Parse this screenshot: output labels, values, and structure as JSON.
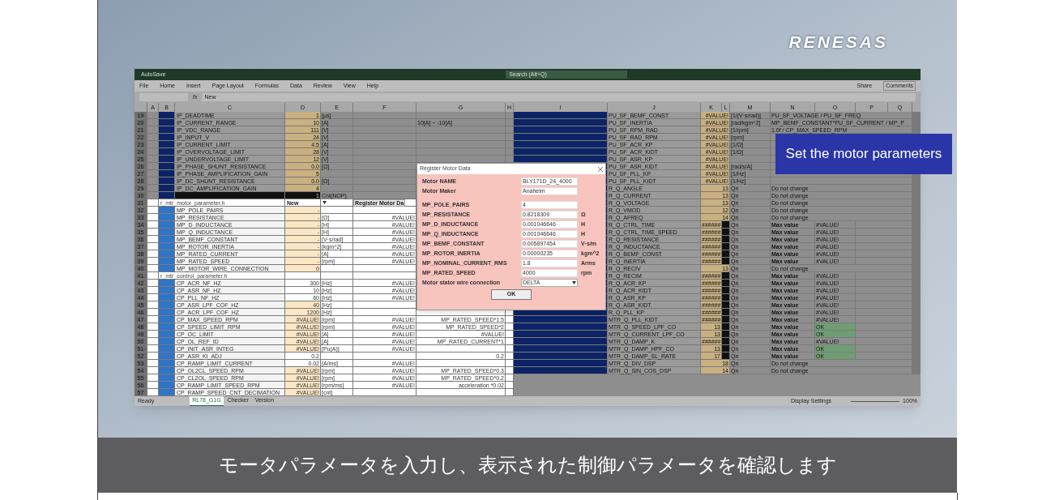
{
  "logo": "RENESAS",
  "excel": {
    "autosave": "AutoSave",
    "search": "Search (Alt+Q)",
    "menu": [
      "File",
      "Home",
      "Insert",
      "Page Layout",
      "Formulas",
      "Data",
      "Review",
      "View",
      "Help"
    ],
    "share": "Share",
    "comments": "Comments",
    "formula_label": "fx",
    "formula_value": "New",
    "columns_left": [
      "A",
      "B",
      "C",
      "D",
      "E",
      "F",
      "G",
      "H"
    ],
    "columns_right": [
      "I",
      "J",
      "K",
      "L",
      "M",
      "N",
      "O",
      "P",
      "Q"
    ],
    "upper_rows": [
      {
        "row": "19",
        "kind": "param",
        "name": "IP_DEADTIME",
        "value": "1",
        "input": true,
        "unit": "[µs]"
      },
      {
        "row": "20",
        "kind": "param",
        "name": "IP_CURRENT_RANGE",
        "value": "10",
        "input": true,
        "unit": "[A]",
        "g": "10[A] ~ -10[A]"
      },
      {
        "row": "21",
        "kind": "param",
        "name": "IP_VDC_RANGE",
        "value": "111",
        "input": true,
        "unit": "[V]"
      },
      {
        "row": "22",
        "kind": "param",
        "name": "IP_INPUT_V",
        "value": "24",
        "input": true,
        "unit": "[V]"
      },
      {
        "row": "23",
        "kind": "param",
        "name": "IP_CURRENT_LIMIT",
        "value": "4.5",
        "input": true,
        "unit": "[A]"
      },
      {
        "row": "24",
        "kind": "param",
        "name": "IP_OVERVOLTAGE_LIMIT",
        "value": "28",
        "input": true,
        "unit": "[V]"
      },
      {
        "row": "25",
        "kind": "param",
        "name": "IP_UNDERVOLTAGE_LIMIT",
        "value": "12",
        "input": true,
        "unit": "[V]"
      },
      {
        "row": "26",
        "kind": "param",
        "name": "IP_PHASE_SHUNT_RESISTANCE",
        "value": "0.0",
        "input": true,
        "unit": "[Ω]"
      },
      {
        "row": "27",
        "kind": "param",
        "name": "IP_PHASE_AMPLIFICATION_GAIN",
        "value": "5",
        "input": true
      },
      {
        "row": "28",
        "kind": "param",
        "name": "IP_DC_SHUNT_RESISTANCE",
        "value": "0.0",
        "input": true,
        "unit": "[Ω]"
      },
      {
        "row": "29",
        "kind": "param",
        "name": "IP_DC_AMPLIFICATION_GAIN",
        "value": "4",
        "input": true
      },
      {
        "row": "30",
        "kind": "dark",
        "value": "1",
        "unit": "Cnt(NOP)"
      }
    ],
    "lower_rows": [
      {
        "row": "31",
        "kind": "header",
        "name": "r_mtr_motor_parameter.h",
        "value": "New",
        "f": "Register Motor Da"
      },
      {
        "row": "32",
        "kind": "param",
        "name": "MP_POLE_PAIRS",
        "value": "-",
        "input": true
      },
      {
        "row": "33",
        "kind": "param",
        "name": "MP_RESISTANCE",
        "value": "-",
        "input": true,
        "unit": "[Ω]",
        "f": "#VALUE!"
      },
      {
        "row": "34",
        "kind": "param",
        "name": "MP_D_INDUCTANCE",
        "value": "-",
        "input": true,
        "unit": "[H]",
        "f": "#VALUE!"
      },
      {
        "row": "35",
        "kind": "param",
        "name": "MP_Q_INDUCTANCE",
        "value": "-",
        "input": true,
        "unit": "[H]",
        "f": "#VALUE!"
      },
      {
        "row": "36",
        "kind": "param",
        "name": "MP_BEMF_CONSTANT",
        "value": "-",
        "input": true,
        "unit": "[V·s/rad]",
        "f": "#VALUE!"
      },
      {
        "row": "37",
        "kind": "param",
        "name": "MP_ROTOR_INERTIA",
        "value": "-",
        "input": true,
        "unit": "[kgm^2]",
        "f": "#VALUE!"
      },
      {
        "row": "38",
        "kind": "param",
        "name": "MP_RATED_CURRENT",
        "value": "-",
        "input": true,
        "unit": "[A]",
        "f": "#VALUE!"
      },
      {
        "row": "39",
        "kind": "param",
        "name": "MP_RATED_SPEED",
        "value": "-",
        "input": true,
        "unit": "[rpm]",
        "f": "#VALUE!"
      },
      {
        "row": "40",
        "kind": "param",
        "name": "MP_MOTOR_WIRE_CONNECTION",
        "value": "0",
        "input": true
      },
      {
        "row": "41",
        "kind": "header",
        "name": "r_mtr_control_parameter.h"
      },
      {
        "row": "42",
        "kind": "param",
        "name": "CP_ACR_NF_HZ",
        "value": "300",
        "input": false,
        "unit": "[Hz]",
        "f": "#VALUE!"
      },
      {
        "row": "43",
        "kind": "param",
        "name": "CP_ASR_NF_HZ",
        "value": "10",
        "input": false,
        "unit": "[Hz]",
        "f": "#VALUE!"
      },
      {
        "row": "44",
        "kind": "param",
        "name": "CP_PLL_NF_HZ",
        "value": "60",
        "input": false,
        "unit": "[Hz]",
        "f": "#VALUE!"
      },
      {
        "row": "45",
        "kind": "param",
        "name": "CP_ASR_LPF_COF_HZ",
        "value": "40",
        "input": true,
        "unit": "[Hz]"
      },
      {
        "row": "46",
        "kind": "param",
        "name": "CP_ACR_LPF_COF_HZ",
        "value": "1200",
        "input": true,
        "unit": "[Hz]"
      },
      {
        "row": "47",
        "kind": "param",
        "name": "CP_MAX_SPEED_RPM",
        "value": "#VALUE!",
        "input": true,
        "unit": "[rpm]",
        "f": "#VALUE!",
        "g": "MP_RATED_SPEED*1.5"
      },
      {
        "row": "48",
        "kind": "param",
        "name": "CP_SPEED_LIMIT_RPM",
        "value": "#VALUE!",
        "input": true,
        "unit": "[rpm]",
        "f": "#VALUE!",
        "g": "MP_RATED_SPEED*2"
      },
      {
        "row": "49",
        "kind": "param",
        "name": "CP_OC_LIMIT",
        "value": "#VALUE!",
        "input": true,
        "unit": "[A]",
        "f": "#VALUE!",
        "g": "#VALUE!"
      },
      {
        "row": "50",
        "kind": "param",
        "name": "CP_OL_REF_ID",
        "value": "#VALUE!",
        "input": true,
        "unit": "[A]",
        "f": "#VALUE!",
        "g": "MP_RATED_CURRENT*1"
      },
      {
        "row": "51",
        "kind": "param",
        "name": "CP_INIT_ASR_INTEG",
        "value": "#VALUE!",
        "input": true,
        "unit": "[Pu(A)]",
        "f": "#VALUE!"
      },
      {
        "row": "52",
        "kind": "param",
        "name": "CP_ASR_KI_ADJ",
        "value": "0.2",
        "input": false,
        "g": "0.2"
      },
      {
        "row": "53",
        "kind": "param",
        "name": "CP_RAMP_LIMIT_CURRENT",
        "value": "0.02",
        "input": false,
        "unit": "[A/ms]",
        "f": "#VALUE!"
      },
      {
        "row": "54",
        "kind": "param",
        "name": "CP_OL2CL_SPEED_RPM",
        "value": "#VALUE!",
        "input": true,
        "unit": "[rpm]",
        "f": "#VALUE!",
        "g": "MP_RATED_SPEED*0.3"
      },
      {
        "row": "55",
        "kind": "param",
        "name": "CP_CL2OL_SPEED_RPM",
        "value": "#VALUE!",
        "input": true,
        "unit": "[rpm]",
        "f": "#VALUE!",
        "g": "MP_RATED_SPEED*0.2"
      },
      {
        "row": "56",
        "kind": "param",
        "name": "CP_RAMP_LIMIT_SPEED_RPM",
        "value": "#VALUE!",
        "input": true,
        "unit": "[rpm/ms]",
        "f": "#VALUE!",
        "g": "acceleration *0.02"
      },
      {
        "row": "57",
        "kind": "param",
        "name": "CP_RAMP_SPEED_CNT_DECIMATION",
        "value": "#VALUE!",
        "input": true,
        "unit": "[cnt]"
      }
    ],
    "right_rows": [
      {
        "kind": "factor",
        "name": "PU_SF_BEMF_CONST",
        "value": "#VALUE!",
        "unit": "[1/(V·s/rad)]",
        "formula": "PU_SF_VOLTAGE / PU_SF_FREQ"
      },
      {
        "kind": "factor",
        "name": "PU_SF_INERTIA",
        "value": "#VALUE!",
        "unit": "[rad/kgm^2]",
        "formula": "MP_BEMF_CONSTANT*PU_SF_CURRENT / MP_P"
      },
      {
        "kind": "factor",
        "name": "PU_SF_RPM_RAD",
        "value": "#VALUE!",
        "unit": "[1/rpm]",
        "formula": "1.0f / CP_MAX_SPEED_RPM"
      },
      {
        "kind": "factor",
        "name": "PU_SF_RAD_RPM",
        "value": "#VALUE!",
        "unit": "[rpm]"
      },
      {
        "kind": "factor",
        "name": "PU_SF_ACR_KP",
        "value": "#VALUE!",
        "unit": "[1/Ω]"
      },
      {
        "kind": "factor",
        "name": "PU_SF_ACR_KIDT",
        "value": "#VALUE!",
        "unit": "[1/Ω]"
      },
      {
        "kind": "factor",
        "name": "PU_SF_ASR_KP",
        "value": "#VALUE!"
      },
      {
        "kind": "factor",
        "name": "PU_SF_ASR_KIDT",
        "value": "#VALUE!",
        "unit": "[rad/s/A]"
      },
      {
        "kind": "factor",
        "name": "PU_SF_PLL_KP",
        "value": "#VALUE!",
        "unit": "[1/Hz]"
      },
      {
        "kind": "factor",
        "name": "PU_SF_PLL_KIDT",
        "value": "#VALUE!",
        "unit": "[1/Hz]"
      },
      {
        "kind": "fixed",
        "name": "R_Q_ANGLE",
        "value": "13",
        "unit": "Qn",
        "note": "Do not change"
      },
      {
        "kind": "fixed",
        "name": "R_Q_CURRENT",
        "value": "13",
        "unit": "Qn",
        "note": "Do not change"
      },
      {
        "kind": "fixed",
        "name": "R_Q_VOLTAGE",
        "value": "13",
        "unit": "Qn",
        "note": "Do not change"
      },
      {
        "kind": "fixed",
        "name": "R_Q_VMOD",
        "value": "12",
        "unit": "Qn",
        "note": "Do not change"
      },
      {
        "kind": "fixed",
        "name": "R_Q_AFREQ",
        "value": "14",
        "unit": "Qn",
        "note": "Do not change"
      },
      {
        "kind": "check",
        "name": "R_Q_CTRL_TIME",
        "value": "######",
        "unit": "Qn",
        "check": "Max value",
        "result": "#VALUE!",
        "ok": false
      },
      {
        "kind": "check",
        "name": "R_Q_CTRL_TIME_SPEED",
        "value": "######",
        "unit": "Qn",
        "check": "Max value",
        "result": "#VALUE!",
        "ok": false
      },
      {
        "kind": "check",
        "name": "R_Q_RESISTANCE",
        "value": "######",
        "unit": "Qn",
        "check": "Max value",
        "result": "#VALUE!",
        "ok": false
      },
      {
        "kind": "check",
        "name": "R_Q_INDUCTANCE",
        "value": "######",
        "unit": "Qn",
        "check": "Max value",
        "result": "#VALUE!",
        "ok": false
      },
      {
        "kind": "check",
        "name": "R_Q_BEMF_CONST",
        "value": "######",
        "unit": "Qn",
        "check": "Max value",
        "result": "#VALUE!",
        "ok": false
      },
      {
        "kind": "check",
        "name": "R_Q_INERTIA",
        "value": "######",
        "unit": "Qn",
        "check": "Max value",
        "result": "#VALUE!",
        "ok": false
      },
      {
        "kind": "fixed",
        "name": "R_Q_RECIV",
        "value": "13",
        "unit": "Qn",
        "note": "Do not change"
      },
      {
        "kind": "check",
        "name": "R_Q_RECIM",
        "value": "######",
        "unit": "Qn",
        "check": "Max value",
        "result": "#VALUE!",
        "ok": false
      },
      {
        "kind": "check",
        "name": "R_Q_ACR_KP",
        "value": "######",
        "unit": "Qn",
        "check": "Max value",
        "result": "#VALUE!",
        "ok": false
      },
      {
        "kind": "check",
        "name": "R_Q_ACR_KIDT",
        "value": "######",
        "unit": "Qn",
        "check": "Max value",
        "result": "#VALUE!",
        "ok": false
      },
      {
        "kind": "check",
        "name": "R_Q_ASR_KP",
        "value": "######",
        "unit": "Qn",
        "check": "Max value",
        "result": "#VALUE!",
        "ok": false
      },
      {
        "kind": "check",
        "name": "R_Q_ASR_KIDT",
        "value": "######",
        "unit": "Qn",
        "check": "Max value",
        "result": "#VALUE!",
        "ok": false
      },
      {
        "kind": "check",
        "name": "R_Q_PLL_KP",
        "value": "######",
        "unit": "Qn",
        "check": "Max value",
        "result": "#VALUE!",
        "ok": false
      },
      {
        "kind": "check",
        "name": "MTR_Q_PLL_KIDT",
        "value": "######",
        "unit": "Qn",
        "check": "Max value",
        "result": "#VALUE!",
        "ok": false
      },
      {
        "kind": "check",
        "name": "MTR_Q_SPEED_LPF_CO",
        "value": "13",
        "unit": "Qn",
        "check": "Max value",
        "result": "OK",
        "ok": true
      },
      {
        "kind": "check",
        "name": "MTR_Q_CURRENT_LPF_CO",
        "value": "13",
        "unit": "Qn",
        "check": "Max value",
        "result": "OK",
        "ok": true
      },
      {
        "kind": "check",
        "name": "MTR_Q_DAMP_K",
        "value": "######",
        "unit": "Qn",
        "check": "Max value",
        "result": "#VALUE!",
        "ok": false
      },
      {
        "kind": "check",
        "name": "MTR_Q_DAMP_HPF_CO",
        "value": "13",
        "unit": "Qn",
        "check": "Max value",
        "result": "OK",
        "ok": true
      },
      {
        "kind": "check",
        "name": "MTR_Q_DAMP_SL_RATE",
        "value": "17",
        "unit": "Qn",
        "check": "Max value",
        "result": "OK",
        "ok": true
      },
      {
        "kind": "fixed",
        "name": "MTR_Q_DIV_DSP",
        "value": "18",
        "unit": "Qn",
        "note": "Do not change"
      },
      {
        "kind": "fixed",
        "name": "MTR_Q_SIN_COS_DSP",
        "value": "14",
        "unit": "Qn",
        "note": "Do not change"
      }
    ],
    "sheet_tabs": [
      {
        "label": "RL78_G1G",
        "selected": true
      },
      {
        "label": "Checker",
        "selected": false
      },
      {
        "label": "Version",
        "selected": false
      }
    ],
    "status": "Ready",
    "display_settings": "Display Settings",
    "zoom": "100%"
  },
  "dialog": {
    "title": "Register Motor Data",
    "motor_fields": [
      {
        "kind": "text",
        "label": "Motor NAME",
        "value": "BLY171D_24_4000"
      },
      {
        "kind": "text",
        "label": "Motor Maker",
        "value": "Anaheim"
      }
    ],
    "parameter_fields": [
      {
        "kind": "text",
        "label": "MP_POLE_PAIRS",
        "value": "4"
      },
      {
        "kind": "text",
        "label": "MP_RESISTANCE",
        "value": "0.8218309",
        "unit": "Ω"
      },
      {
        "kind": "text",
        "label": "MP_D_INDUCTANCE",
        "value": "0.001046646",
        "unit": "H"
      },
      {
        "kind": "text",
        "label": "MP_Q_INDUCTANCE",
        "value": "0.001046646",
        "unit": "H"
      },
      {
        "kind": "text",
        "label": "MP_BEMF_CONSTANT",
        "value": "0.005897454",
        "unit": "V·s/m"
      },
      {
        "kind": "text",
        "label": "MP_ROTOR_INERTIA",
        "value": "0.00000235",
        "unit": "kgm^2"
      },
      {
        "kind": "text",
        "label": "MP_NOMINAL_CURRENT_RMS",
        "value": "1.8",
        "unit": "Arms"
      },
      {
        "kind": "text",
        "label": "MP_RATED_SPEED",
        "value": "4000",
        "unit": "rpm"
      },
      {
        "kind": "select",
        "label": "Motor stator wire connection",
        "value": "DELTA"
      }
    ],
    "ok": "OK"
  },
  "callout": "Set the motor parameters",
  "subtitle": "モータパラメータを入力し、表示された制御パラメータを確認します"
}
